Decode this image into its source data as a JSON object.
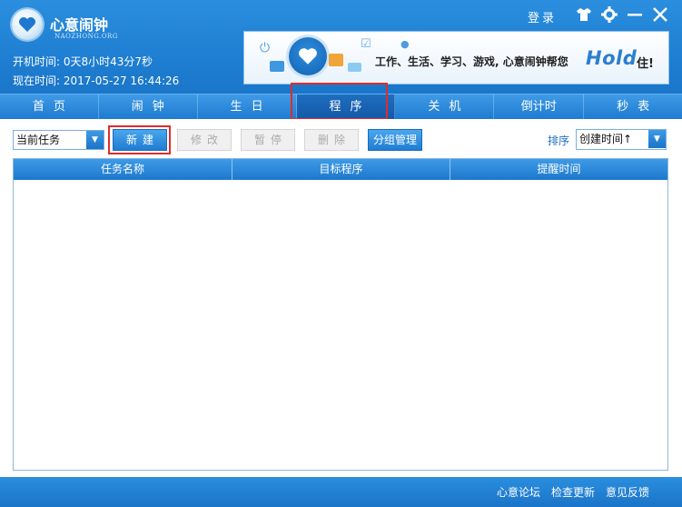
{
  "app": {
    "title": "心意闹钟",
    "subtitle": "NAOZHONG.ORG",
    "uptime": "开机时间: 0天8小时43分7秒",
    "current_time": "现在时间: 2017-05-27 16:44:26"
  },
  "window_controls": {
    "login": "登录",
    "skin_icon": "tshirt-icon",
    "settings_icon": "gear-icon",
    "minimize_icon": "minimize-icon",
    "close_icon": "close-icon"
  },
  "banner": {
    "text": "工作、生活、学习、游戏, 心意闹钟帮您",
    "hold": "Hold",
    "end": "住!"
  },
  "tabs": [
    {
      "label": "首页"
    },
    {
      "label": "闹钟"
    },
    {
      "label": "生日"
    },
    {
      "label": "程序",
      "active": true
    },
    {
      "label": "关机"
    },
    {
      "label": "倒计时"
    },
    {
      "label": "秒表"
    }
  ],
  "toolbar": {
    "task_filter": "当前任务",
    "new_label": "新建",
    "edit_label": "修改",
    "pause_label": "暂停",
    "delete_label": "删除",
    "group_label": "分组管理",
    "sort_label": "排序",
    "sort_value": "创建时间↑"
  },
  "table": {
    "columns": [
      "任务名称",
      "目标程序",
      "提醒时间"
    ],
    "rows": []
  },
  "footer": {
    "forum": "心意论坛",
    "update": "检查更新",
    "feedback": "意见反馈"
  },
  "colors": {
    "primary": "#1f7fd2",
    "highlight": "#e02c2c"
  }
}
